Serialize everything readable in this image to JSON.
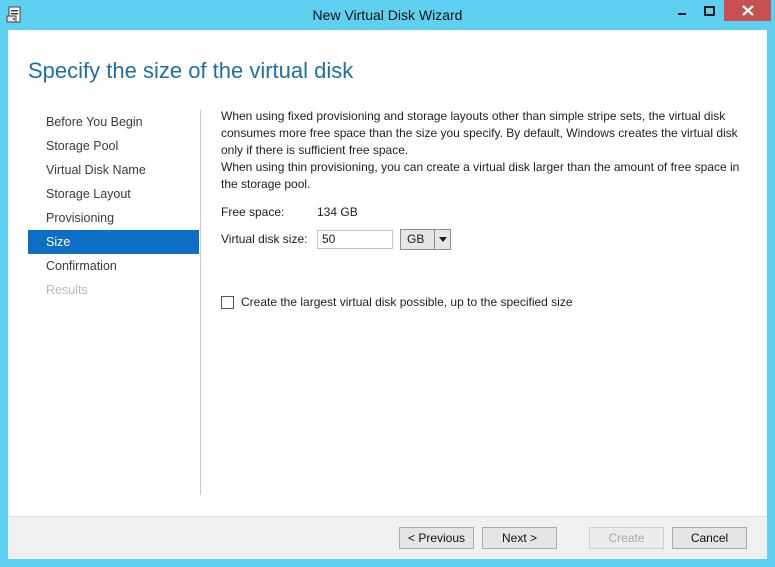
{
  "window": {
    "title": "New Virtual Disk Wizard"
  },
  "page_title": "Specify the size of the virtual disk",
  "steps": [
    {
      "label": "Before You Begin",
      "state": "normal"
    },
    {
      "label": "Storage Pool",
      "state": "normal"
    },
    {
      "label": "Virtual Disk Name",
      "state": "normal"
    },
    {
      "label": "Storage Layout",
      "state": "normal"
    },
    {
      "label": "Provisioning",
      "state": "normal"
    },
    {
      "label": "Size",
      "state": "active"
    },
    {
      "label": "Confirmation",
      "state": "normal"
    },
    {
      "label": "Results",
      "state": "disabled"
    }
  ],
  "content": {
    "paragraph1": "When using fixed provisioning and storage layouts other than simple stripe sets, the virtual disk consumes more free space than the size you specify. By default, Windows creates the virtual disk only if there is sufficient free space.",
    "paragraph2": "When using thin provisioning, you can create a virtual disk larger than the amount of free space in the storage pool.",
    "free_space_label": "Free space:",
    "free_space_value": "134 GB",
    "size_label": "Virtual disk size:",
    "size_value": "50",
    "unit_value": "GB",
    "largest_checkbox_label": "Create the largest virtual disk possible, up to the specified size",
    "largest_checked": false
  },
  "buttons": {
    "previous": "< Previous",
    "next": "Next >",
    "create": "Create",
    "cancel": "Cancel"
  },
  "colors": {
    "frame": "#5fd0f0",
    "accent": "#1e6fa5",
    "active_step": "#0d6fc4",
    "close_button": "#c75050"
  }
}
